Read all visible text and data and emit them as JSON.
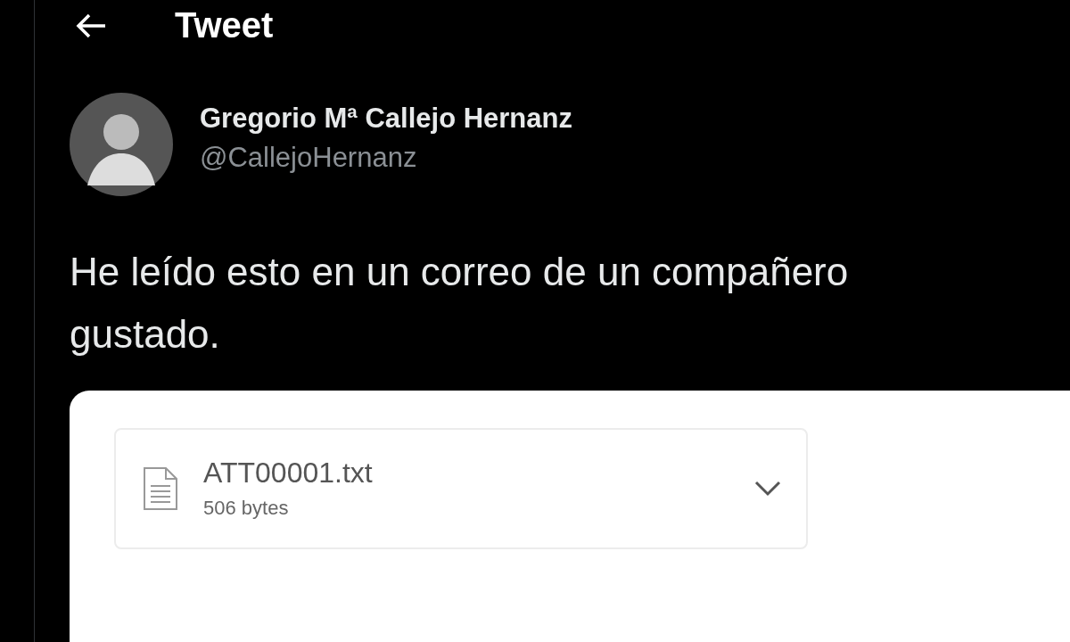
{
  "header": {
    "title": "Tweet"
  },
  "author": {
    "name": "Gregorio Mª Callejo Hernanz",
    "handle": "@CallejoHernanz"
  },
  "tweet": {
    "lines": [
      "He leído esto en un correo de un compañero",
      "gustado."
    ]
  },
  "attachment": {
    "filename": "ATT00001.txt",
    "size": "506 bytes"
  }
}
